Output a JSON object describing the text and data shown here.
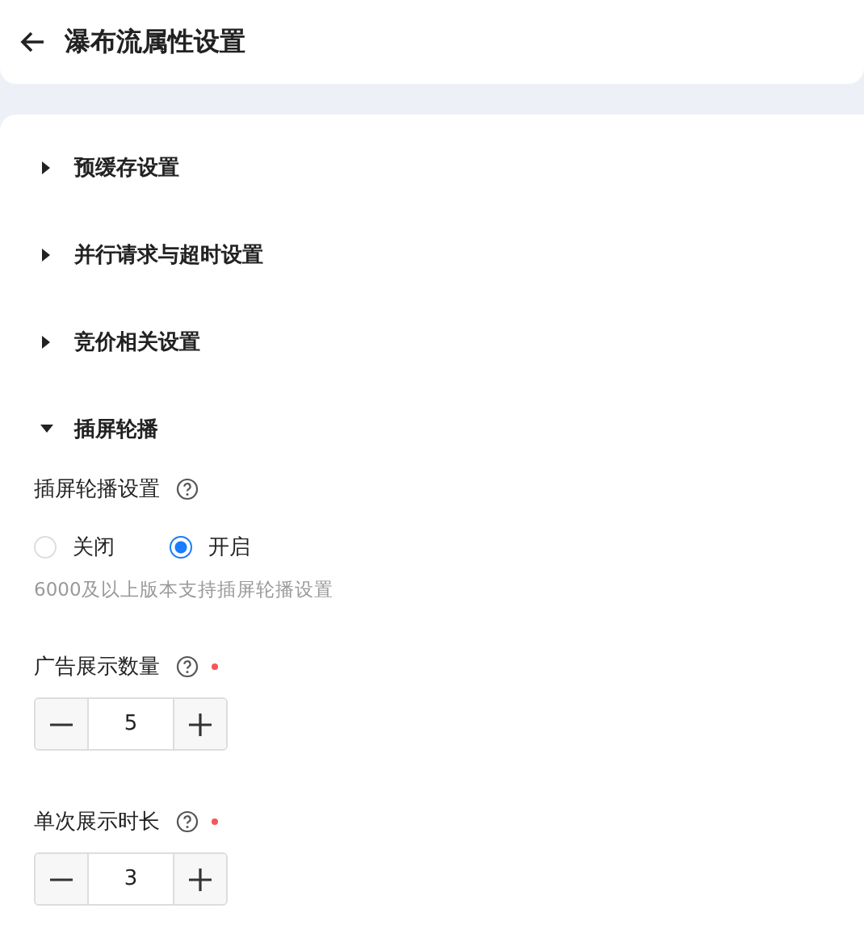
{
  "header": {
    "title": "瀑布流属性设置"
  },
  "sections": [
    {
      "title": "预缓存设置",
      "expanded": false
    },
    {
      "title": "并行请求与超时设置",
      "expanded": false
    },
    {
      "title": "竞价相关设置",
      "expanded": false
    },
    {
      "title": "插屏轮播",
      "expanded": true,
      "fields": [
        {
          "kind": "radio",
          "label": "插屏轮播设置",
          "options": [
            {
              "label": "关闭",
              "selected": false
            },
            {
              "label": "开启",
              "selected": true
            }
          ],
          "hint": "6000及以上版本支持插屏轮播设置"
        },
        {
          "kind": "stepper",
          "label": "广告展示数量",
          "required": true,
          "value": "5"
        },
        {
          "kind": "stepper",
          "label": "单次展示时长",
          "required": true,
          "value": "3"
        }
      ]
    }
  ]
}
